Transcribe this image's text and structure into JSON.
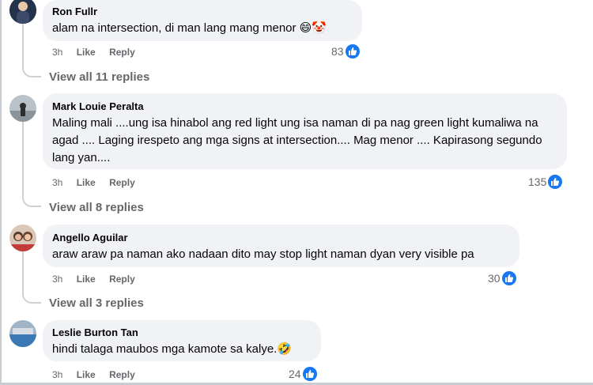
{
  "comments": [
    {
      "author": "Ron Fullr",
      "text": "alam na intersection, di man lang mang menor 😄🤡",
      "time": "3h",
      "like": "Like",
      "reply": "Reply",
      "reactions": "83",
      "view_replies": "View all 11 replies"
    },
    {
      "author": "Mark Louie Peralta",
      "text": "Maling mali ....ung isa hinabol ang red light ung isa naman di pa nag green light kumaliwa na agad .... Laging irespeto ang mga signs at intersection.... Mag menor .... Kapirasong segundo lang yan....",
      "time": "3h",
      "like": "Like",
      "reply": "Reply",
      "reactions": "135",
      "view_replies": "View all 8 replies"
    },
    {
      "author": "Angello Aguilar",
      "text": "araw araw pa naman ako nadaan dito may stop light naman dyan very visible pa",
      "time": "3h",
      "like": "Like",
      "reply": "Reply",
      "reactions": "30",
      "view_replies": "View all 3 replies"
    },
    {
      "author": "Leslie Burton Tan",
      "text": "hindi talaga maubos mga kamote sa kalye.🤣",
      "time": "3h",
      "like": "Like",
      "reply": "Reply",
      "reactions": "24"
    }
  ],
  "colors": {
    "bubble": "#f0f2f5",
    "secondary_text": "#65676b",
    "like_blue": "#1877f2"
  }
}
